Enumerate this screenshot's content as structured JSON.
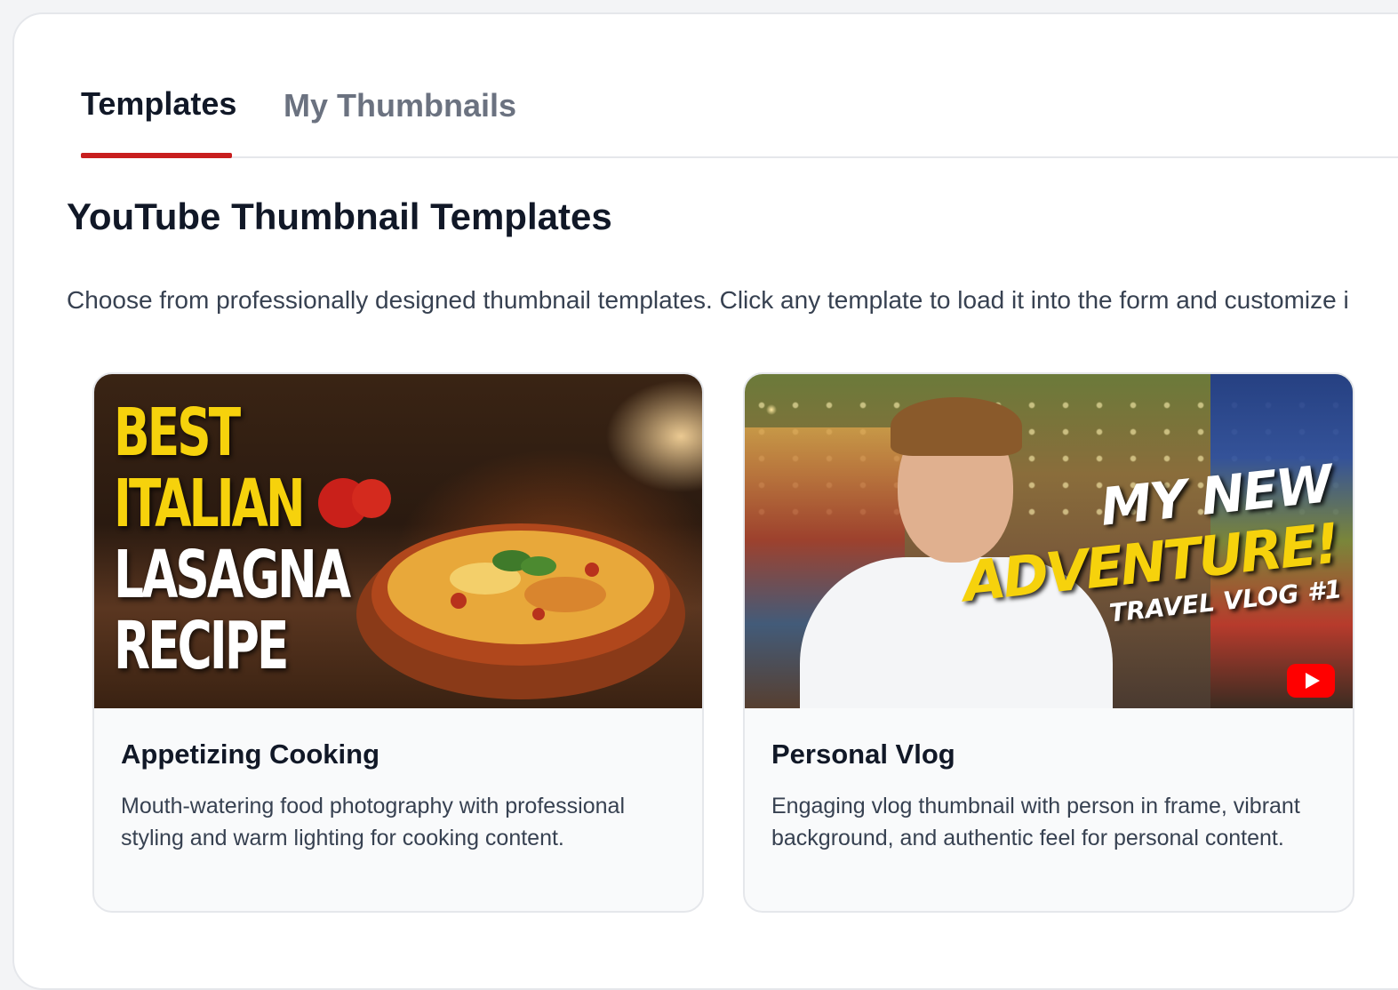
{
  "tabs": [
    {
      "label": "Templates",
      "active": true
    },
    {
      "label": "My Thumbnails",
      "active": false
    }
  ],
  "accent_color": "#c81e1e",
  "section": {
    "title": "YouTube Thumbnail Templates",
    "description": "Choose from professionally designed thumbnail templates. Click any template to load it into the form and customize i"
  },
  "templates": [
    {
      "title": "Appetizing Cooking",
      "description": "Mouth-watering food photography with professional styling and warm lighting for cooking content.",
      "thumbnail_text": [
        "BEST",
        "ITALIAN",
        "LASAGNA",
        "RECIPE"
      ]
    },
    {
      "title": "Personal Vlog",
      "description": "Engaging vlog thumbnail with person in frame, vibrant background, and authentic feel for personal content.",
      "thumbnail_text": [
        "MY NEW",
        "ADVENTURE!",
        "TRAVEL VLOG #1"
      ]
    }
  ]
}
